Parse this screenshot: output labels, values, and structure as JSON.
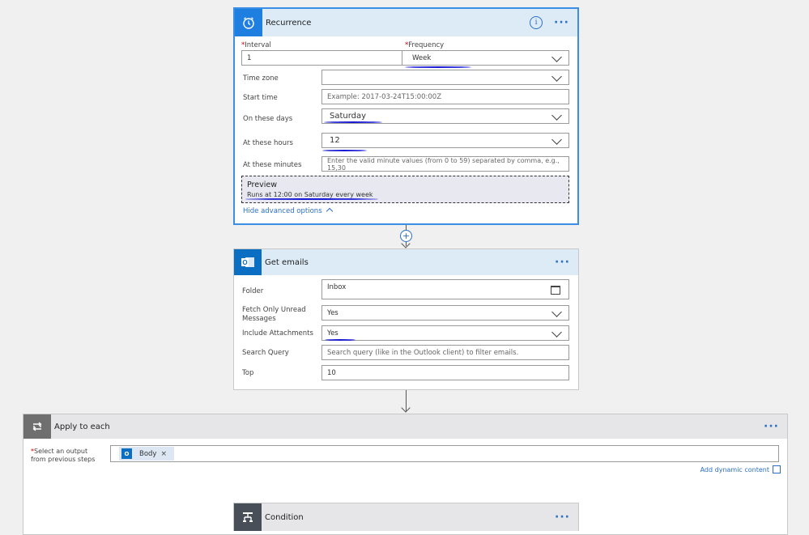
{
  "recurrence": {
    "title": "Recurrence",
    "info_icon": "info-icon",
    "more": "···",
    "interval_label": "Interval",
    "interval_value": "1",
    "frequency_label": "Frequency",
    "frequency_value": "Week",
    "timezone_label": "Time zone",
    "timezone_value": "",
    "start_label": "Start time",
    "start_placeholder": "Example: 2017-03-24T15:00:00Z",
    "days_label": "On these days",
    "days_value": "Saturday",
    "hours_label": "At these hours",
    "hours_value": "12",
    "minutes_label": "At these minutes",
    "minutes_placeholder": "Enter the valid minute values (from 0 to 59) separated by comma, e.g., 15,30",
    "preview_title": "Preview",
    "preview_text": "Runs at 12:00 on Saturday every week",
    "hide_advanced": "Hide advanced options"
  },
  "get_emails": {
    "title": "Get emails",
    "more": "···",
    "folder_label": "Folder",
    "folder_value": "Inbox",
    "unread_label_1": "Fetch Only Unread",
    "unread_label_2": "Messages",
    "unread_value": "Yes",
    "attachments_label": "Include Attachments",
    "attachments_value": "Yes",
    "search_label": "Search Query",
    "search_placeholder": "Search query (like in the Outlook client) to filter emails.",
    "top_label": "Top",
    "top_value": "10"
  },
  "apply_each": {
    "title": "Apply to each",
    "more": "···",
    "select_label_1": "Select an output",
    "select_label_2": "from previous steps",
    "token_label": "Body",
    "token_remove": "×",
    "add_dynamic": "Add dynamic content"
  },
  "condition": {
    "title": "Condition",
    "more": "···"
  },
  "colors": {
    "accent_blue": "#2b6fc7",
    "selected_border": "#3a8ee6",
    "header_light_blue": "#ddebf7",
    "header_gray": "#e6e6e8",
    "annotation_ink": "#1a1ad6"
  }
}
